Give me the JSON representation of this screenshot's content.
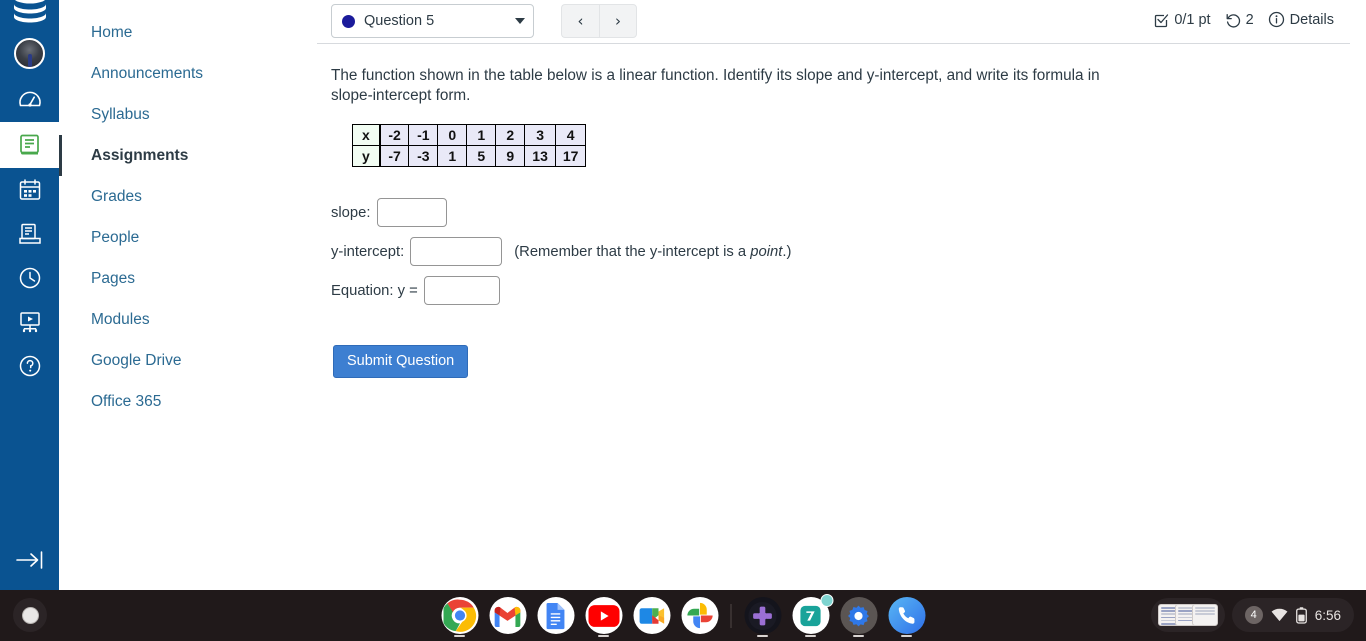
{
  "global_nav": {
    "items": [
      {
        "name": "canvas-logo",
        "label": "Canvas"
      },
      {
        "name": "account-avatar",
        "label": "Account"
      },
      {
        "name": "dashboard",
        "label": "Dashboard"
      },
      {
        "name": "courses",
        "label": "Courses",
        "active": true
      },
      {
        "name": "calendar",
        "label": "Calendar"
      },
      {
        "name": "inbox",
        "label": "Inbox"
      },
      {
        "name": "history",
        "label": "History"
      },
      {
        "name": "studio",
        "label": "Studio"
      },
      {
        "name": "help",
        "label": "Help"
      },
      {
        "name": "collapse",
        "label": "Minimize Global Navigation"
      }
    ]
  },
  "course_nav": {
    "items": [
      {
        "label": "Home",
        "active": false
      },
      {
        "label": "Announcements",
        "active": false
      },
      {
        "label": "Syllabus",
        "active": false
      },
      {
        "label": "Assignments",
        "active": true
      },
      {
        "label": "Grades",
        "active": false
      },
      {
        "label": "People",
        "active": false
      },
      {
        "label": "Pages",
        "active": false
      },
      {
        "label": "Modules",
        "active": false
      },
      {
        "label": "Google Drive",
        "active": false
      },
      {
        "label": "Office 365",
        "active": false
      }
    ]
  },
  "question_header": {
    "selected_question": "Question 5",
    "dot_color": "#1b1b9b",
    "prev_label": "‹",
    "next_label": "›",
    "points": "0/1 pt",
    "attempts": "2",
    "details_label": "Details"
  },
  "question": {
    "prompt": "The function shown in the table below is a linear function. Identify its slope and y-intercept, and write its formula in slope-intercept form.",
    "table": {
      "row_labels": [
        "x",
        "y"
      ],
      "x": [
        "-2",
        "-1",
        "0",
        "1",
        "2",
        "3",
        "4"
      ],
      "y": [
        "-7",
        "-3",
        "1",
        "5",
        "9",
        "13",
        "17"
      ]
    },
    "fields": [
      {
        "label": "slope:",
        "value": "",
        "placeholder": ""
      },
      {
        "label": "y-intercept:",
        "value": "",
        "placeholder": ""
      },
      {
        "label": "Equation: y =",
        "value": "",
        "placeholder": ""
      }
    ],
    "hint_prefix": "(Remember that the y-intercept is a ",
    "hint_italic": "point",
    "hint_suffix": ".)",
    "submit_label": "Submit Question",
    "submit_color": "#3d7fd1"
  },
  "chart_data": {
    "type": "table",
    "title": "Linear function value table",
    "categories": [
      "-2",
      "-1",
      "0",
      "1",
      "2",
      "3",
      "4"
    ],
    "xlabel": "x",
    "ylabel": "y",
    "series": [
      {
        "name": "y",
        "values": [
          -7,
          -3,
          1,
          5,
          9,
          13,
          17
        ]
      }
    ],
    "x": [
      -2,
      -1,
      0,
      1,
      2,
      3,
      4
    ]
  },
  "shelf": {
    "apps": [
      {
        "name": "chrome",
        "label": "Google Chrome",
        "running": true
      },
      {
        "name": "gmail",
        "label": "Gmail",
        "running": false
      },
      {
        "name": "google-docs",
        "label": "Google Docs",
        "running": false
      },
      {
        "name": "youtube",
        "label": "YouTube",
        "running": true
      },
      {
        "name": "google-meet",
        "label": "Google Meet",
        "running": false
      },
      {
        "name": "google-photos",
        "label": "Google Photos",
        "running": false
      },
      {
        "name": "game-controller",
        "label": "Games",
        "running": true
      },
      {
        "name": "seven-app",
        "label": "App",
        "running": true
      },
      {
        "name": "settings",
        "label": "Settings",
        "running": true
      },
      {
        "name": "phone-hub",
        "label": "Phone Hub",
        "running": true
      }
    ],
    "tray": {
      "notification_count": "4",
      "time": "6:56"
    }
  }
}
